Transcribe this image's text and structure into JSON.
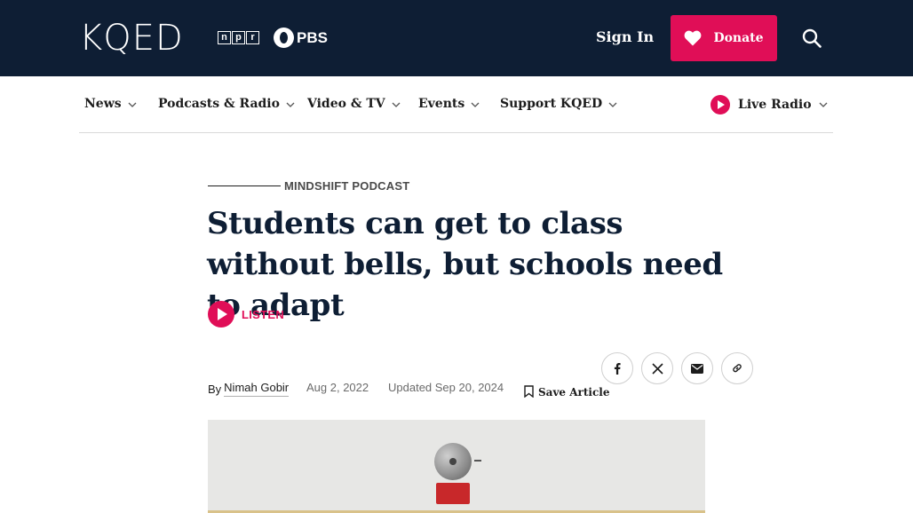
{
  "header": {
    "logo_text": "KQED",
    "npr_letters": [
      "n",
      "p",
      "r"
    ],
    "pbs_text": "PBS",
    "signin_label": "Sign In",
    "donate_label": "Donate",
    "bg_color": "#0e1e34",
    "accent_color": "#e00e57"
  },
  "nav": {
    "items": [
      {
        "label": "News"
      },
      {
        "label": "Podcasts & Radio"
      },
      {
        "label": "Video & TV"
      },
      {
        "label": "Events"
      },
      {
        "label": "Support KQED"
      }
    ],
    "live_radio_label": "Live Radio"
  },
  "article": {
    "kicker": "MINDSHIFT PODCAST",
    "headline": "Students can get to class without bells, but schools need to adapt",
    "listen_label": "LISTEN",
    "byline_prefix": "By",
    "author": "Nimah Gobir",
    "published": "Aug 2, 2022",
    "updated": "Updated Sep 20, 2024",
    "save_label": "Save Article",
    "share": [
      "facebook-icon",
      "x-icon",
      "email-icon",
      "link-icon"
    ]
  }
}
